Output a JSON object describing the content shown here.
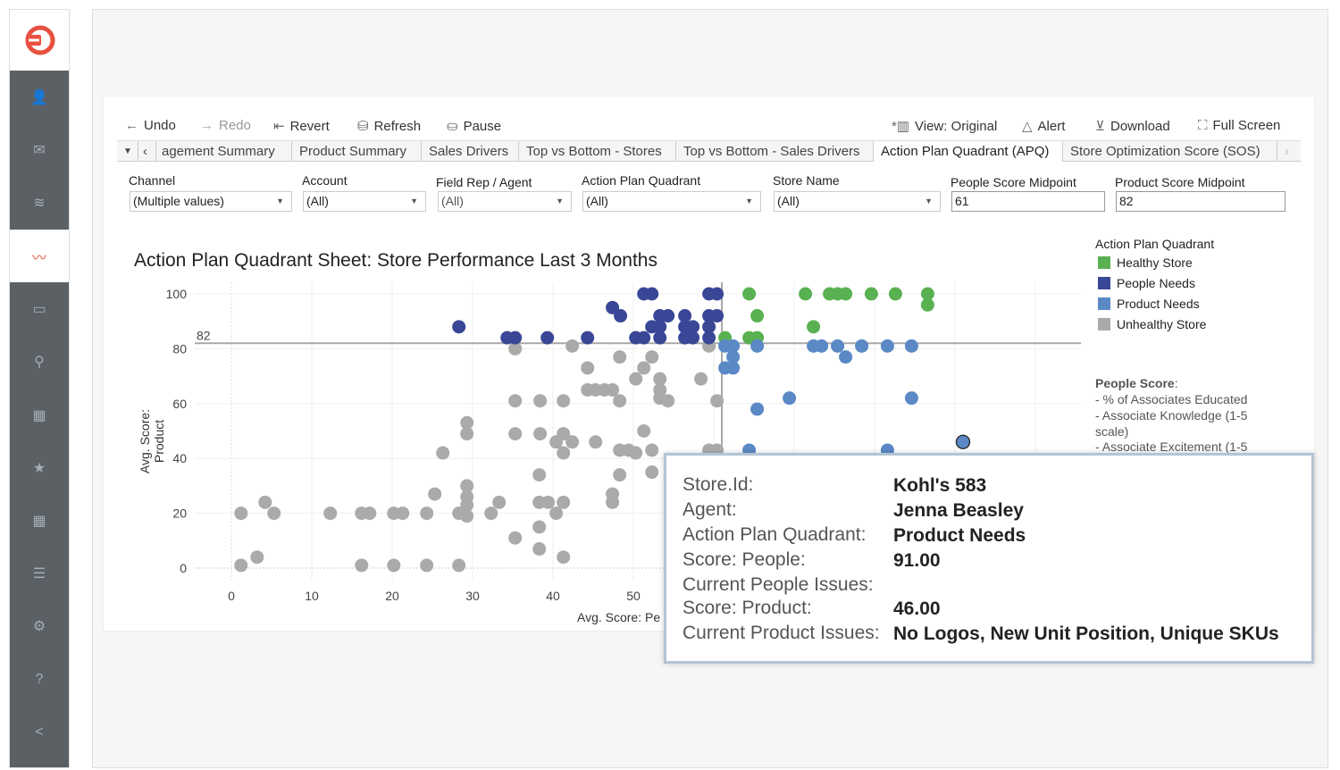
{
  "sidebar": {
    "items": [
      {
        "icon": "user-icon",
        "glyph": "👤"
      },
      {
        "icon": "mail-icon",
        "glyph": "✉"
      },
      {
        "icon": "rss-icon",
        "glyph": "≋"
      },
      {
        "icon": "analytics-icon",
        "glyph": "〰",
        "active": true
      },
      {
        "icon": "store-icon",
        "glyph": "▭"
      },
      {
        "icon": "agent-icon",
        "glyph": "⚲"
      },
      {
        "icon": "calendar-icon",
        "glyph": "▦"
      },
      {
        "icon": "star-icon",
        "glyph": "★"
      },
      {
        "icon": "calendar-icon",
        "glyph": "▦"
      },
      {
        "icon": "list-icon",
        "glyph": "☰"
      },
      {
        "icon": "gear-icon",
        "glyph": "⚙"
      },
      {
        "icon": "help-icon",
        "glyph": "?"
      },
      {
        "icon": "collapse-icon",
        "glyph": "<"
      }
    ]
  },
  "toolbar": {
    "undo": "Undo",
    "redo": "Redo",
    "revert": "Revert",
    "refresh": "Refresh",
    "pause": "Pause",
    "view": "View: Original",
    "alert": "Alert",
    "download": "Download",
    "fullscreen": "Full Screen"
  },
  "tabs": [
    "agement Summary",
    "Product Summary",
    "Sales Drivers",
    "Top vs Bottom - Stores",
    "Top vs Bottom - Sales Drivers",
    "Action Plan Quadrant (APQ)",
    "Store Optimization Score (SOS)"
  ],
  "active_tab": "Action Plan Quadrant (APQ)",
  "filters": {
    "channel": {
      "label": "Channel",
      "value": "(Multiple values)"
    },
    "account": {
      "label": "Account",
      "value": "(All)"
    },
    "field_rep": {
      "label": "Field Rep / Agent",
      "value": "(All)"
    },
    "apq": {
      "label": "Action Plan Quadrant",
      "value": "(All)"
    },
    "store_name": {
      "label": "Store Name",
      "value": "(All)"
    },
    "people_mid": {
      "label": "People Score Midpoint",
      "value": "61"
    },
    "product_mid": {
      "label": "Product Score Midpoint",
      "value": "82"
    }
  },
  "legend": {
    "title": "Action Plan Quadrant",
    "items": [
      {
        "label": "Healthy Store",
        "color": "#59b151"
      },
      {
        "label": "People Needs",
        "color": "#3a4796"
      },
      {
        "label": "Product Needs",
        "color": "#5a89c6"
      },
      {
        "label": "Unhealthy Store",
        "color": "#aaaaaa"
      }
    ]
  },
  "notes": {
    "heading": "People Score",
    "lines": [
      "- % of Associates Educated",
      "- Associate Knowledge (1-5",
      "scale)",
      "- Associate Excitement (1-5"
    ]
  },
  "tooltip": {
    "rows": [
      {
        "key": "Store.Id:",
        "value": "Kohl's 583"
      },
      {
        "key": "Agent:",
        "value": "Jenna Beasley"
      },
      {
        "key": "Action Plan Quadrant:",
        "value": "Product Needs"
      },
      {
        "key": "Score: People:",
        "value": "91.00"
      },
      {
        "key": "Current People Issues:",
        "value": ""
      },
      {
        "key": "Score: Product:",
        "value": "46.00"
      },
      {
        "key": "Current Product Issues:",
        "value": "No Logos, New Unit Position, Unique SKUs"
      }
    ]
  },
  "chart_data": {
    "type": "scatter",
    "title": "Action Plan Quadrant Sheet: Store Performance Last 3 Months",
    "xlabel": "Avg. Score: Pe",
    "ylabel": "Avg. Score: Product",
    "xticks": [
      "0",
      "10",
      "20",
      "30",
      "40",
      "50"
    ],
    "yticks": [
      "0",
      "20",
      "40",
      "60",
      "80",
      "100"
    ],
    "ylim": [
      0,
      100
    ],
    "xlim": [
      -4,
      105
    ],
    "reference_lines": {
      "x": 61,
      "y": 82,
      "y_label": "82"
    },
    "grid": true,
    "legend_position": "right",
    "highlighted": {
      "x": 91,
      "y": 46
    },
    "series": [
      {
        "name": "Healthy Store",
        "color": "#59b151",
        "points": [
          [
            61.4,
            84
          ],
          [
            64.4,
            100
          ],
          [
            65.4,
            92
          ],
          [
            64.4,
            84
          ],
          [
            65.4,
            84
          ],
          [
            71.4,
            100
          ],
          [
            72.4,
            88
          ],
          [
            74.4,
            100
          ],
          [
            75.4,
            100
          ],
          [
            76.4,
            100
          ],
          [
            79.6,
            100
          ],
          [
            82.6,
            100
          ],
          [
            86.6,
            100
          ],
          [
            86.6,
            96
          ]
        ]
      },
      {
        "name": "People Needs",
        "color": "#3a4796",
        "points": [
          [
            28.3,
            88
          ],
          [
            34.3,
            84
          ],
          [
            35.3,
            84
          ],
          [
            39.3,
            84
          ],
          [
            44.3,
            84
          ],
          [
            47.4,
            95
          ],
          [
            48.4,
            92
          ],
          [
            51.3,
            100
          ],
          [
            52.3,
            100
          ],
          [
            50.3,
            84
          ],
          [
            51.3,
            84
          ],
          [
            53.3,
            92
          ],
          [
            54.3,
            92
          ],
          [
            52.3,
            88
          ],
          [
            53.3,
            88
          ],
          [
            53.3,
            84
          ],
          [
            56.4,
            92
          ],
          [
            56.4,
            88
          ],
          [
            57.4,
            88
          ],
          [
            56.4,
            84
          ],
          [
            57.4,
            84
          ],
          [
            59.4,
            100
          ],
          [
            60.4,
            100
          ],
          [
            59.4,
            92
          ],
          [
            60.4,
            92
          ],
          [
            59.4,
            88
          ],
          [
            59.4,
            84
          ]
        ]
      },
      {
        "name": "Product Needs",
        "color": "#5a89c6",
        "points": [
          [
            61.4,
            81
          ],
          [
            61.4,
            73
          ],
          [
            62.4,
            81
          ],
          [
            62.4,
            77
          ],
          [
            62.4,
            73
          ],
          [
            65.4,
            81
          ],
          [
            65.4,
            58
          ],
          [
            69.4,
            62
          ],
          [
            72.4,
            81
          ],
          [
            73.4,
            81
          ],
          [
            75.4,
            81
          ],
          [
            76.4,
            77
          ],
          [
            78.4,
            81
          ],
          [
            81.6,
            81
          ],
          [
            84.6,
            81
          ],
          [
            84.6,
            62
          ],
          [
            64.4,
            43
          ],
          [
            81.6,
            43
          ],
          [
            91,
            46
          ]
        ]
      },
      {
        "name": "Unhealthy Store",
        "color": "#aaaaaa",
        "points": [
          [
            1.2,
            20
          ],
          [
            1.2,
            1
          ],
          [
            4.2,
            24
          ],
          [
            3.2,
            4
          ],
          [
            5.3,
            20
          ],
          [
            12.3,
            20
          ],
          [
            16.2,
            20
          ],
          [
            17.2,
            20
          ],
          [
            16.2,
            1
          ],
          [
            20.2,
            20
          ],
          [
            21.3,
            20
          ],
          [
            20.2,
            1
          ],
          [
            24.3,
            20
          ],
          [
            25.3,
            27
          ],
          [
            24.3,
            1
          ],
          [
            26.3,
            42
          ],
          [
            28.3,
            20
          ],
          [
            28.3,
            1
          ],
          [
            29.3,
            53
          ],
          [
            29.3,
            49
          ],
          [
            29.3,
            30
          ],
          [
            29.3,
            26
          ],
          [
            29.3,
            23
          ],
          [
            29.3,
            19
          ],
          [
            32.3,
            20
          ],
          [
            33.3,
            24
          ],
          [
            35.3,
            80
          ],
          [
            35.3,
            61
          ],
          [
            35.3,
            49
          ],
          [
            35.3,
            11
          ],
          [
            38.4,
            61
          ],
          [
            38.4,
            49
          ],
          [
            38.3,
            34
          ],
          [
            38.3,
            24
          ],
          [
            39.4,
            24
          ],
          [
            38.3,
            15
          ],
          [
            38.3,
            7
          ],
          [
            40.4,
            20
          ],
          [
            41.3,
            61
          ],
          [
            41.3,
            49
          ],
          [
            40.4,
            46
          ],
          [
            42.4,
            46
          ],
          [
            41.3,
            42
          ],
          [
            41.3,
            24
          ],
          [
            41.3,
            4
          ],
          [
            42.4,
            81
          ],
          [
            44.3,
            73
          ],
          [
            44.3,
            65
          ],
          [
            45.3,
            65
          ],
          [
            46.4,
            65
          ],
          [
            47.4,
            65
          ],
          [
            45.3,
            46
          ],
          [
            48.3,
            77
          ],
          [
            48.3,
            61
          ],
          [
            48.3,
            43
          ],
          [
            49.4,
            43
          ],
          [
            50.3,
            42
          ],
          [
            48.3,
            34
          ],
          [
            47.4,
            27
          ],
          [
            47.4,
            24
          ],
          [
            50.3,
            69
          ],
          [
            51.3,
            73
          ],
          [
            51.3,
            50
          ],
          [
            52.3,
            77
          ],
          [
            53.3,
            69
          ],
          [
            53.3,
            65
          ],
          [
            53.3,
            62
          ],
          [
            54.3,
            61
          ],
          [
            52.3,
            43
          ],
          [
            52.3,
            35
          ],
          [
            58.4,
            69
          ],
          [
            59.4,
            81
          ],
          [
            60.4,
            61
          ],
          [
            59.4,
            43
          ],
          [
            60.4,
            43
          ]
        ]
      }
    ]
  }
}
